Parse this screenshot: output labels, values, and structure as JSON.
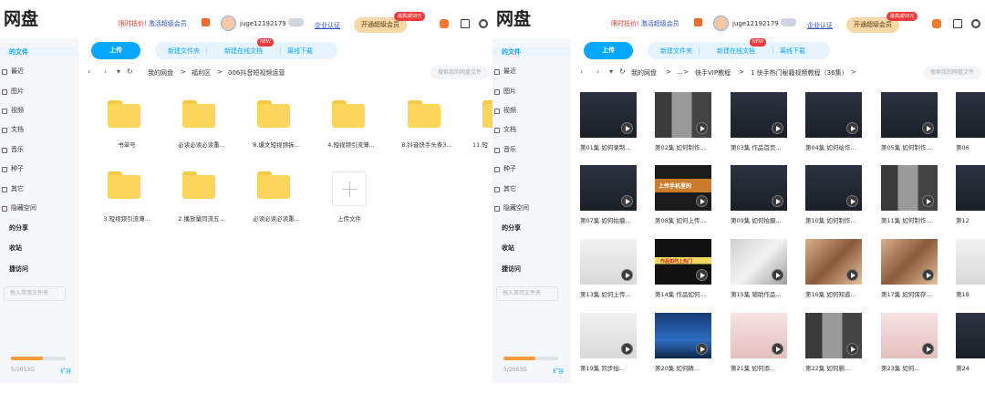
{
  "left": {
    "brand": "网盘",
    "topbar": {
      "promo_prefix": "限时抵价!",
      "promo_text": "激活超级会员",
      "username": "juge12192179",
      "cert_label": "企业认证",
      "open_vip_label": "开通超级会员",
      "discount_badge": "最高减58元"
    },
    "sidebar": {
      "items": [
        {
          "label": "的文件",
          "type": "active"
        },
        {
          "label": "最近",
          "type": "sub"
        },
        {
          "label": "图片",
          "type": "sub"
        },
        {
          "label": "视频",
          "type": "sub"
        },
        {
          "label": "文档",
          "type": "sub"
        },
        {
          "label": "音乐",
          "type": "sub"
        },
        {
          "label": "种子",
          "type": "sub"
        },
        {
          "label": "其它",
          "type": "sub"
        },
        {
          "label": "隐藏空间",
          "type": "sub"
        },
        {
          "label": "的分享",
          "type": "bold"
        },
        {
          "label": "收站",
          "type": "bold"
        },
        {
          "label": "捷访问",
          "type": "bold"
        }
      ],
      "add_folder_placeholder": "拖入常用文件夹",
      "quota_text": "5/2053G",
      "expand_label": "扩容",
      "quota_fraction": 0.58
    },
    "toolbar": {
      "upload_label": "上传",
      "new_folder_label": "新建文件夹",
      "new_online_doc_label": "新建在线文档",
      "offline_download_label": "离线下载",
      "new_badge": "NEW"
    },
    "breadcrumb": [
      "我的网盘",
      "福利区",
      "006抖音短视频运营"
    ],
    "search_placeholder": "搜索我的网盘文件",
    "folders": [
      {
        "name": "书单号"
      },
      {
        "name": "必读必读必读重..."
      },
      {
        "name": "8.爆文短视频拆..."
      },
      {
        "name": "4.短视频引流薄..."
      },
      {
        "name": "8.抖音快手头条3..."
      },
      {
        "name": "11.短"
      },
      {
        "name": "3.短视频引流薄..."
      },
      {
        "name": "2.播放量同流五..."
      },
      {
        "name": "必读必读必读重..."
      }
    ],
    "upload_tile_label": "上传文件"
  },
  "right": {
    "brand": "网盘",
    "topbar": {
      "promo_prefix": "限时抵价!",
      "promo_text": "激活超级会员",
      "username": "juge12192179",
      "cert_label": "企业认证",
      "open_vip_label": "开通超级会员",
      "discount_badge": "最高减58元"
    },
    "sidebar": {
      "items": [
        {
          "label": "的文件",
          "type": "active"
        },
        {
          "label": "最近",
          "type": "sub"
        },
        {
          "label": "图片",
          "type": "sub"
        },
        {
          "label": "视频",
          "type": "sub"
        },
        {
          "label": "文档",
          "type": "sub"
        },
        {
          "label": "音乐",
          "type": "sub"
        },
        {
          "label": "种子",
          "type": "sub"
        },
        {
          "label": "其它",
          "type": "sub"
        },
        {
          "label": "隐藏空间",
          "type": "sub"
        },
        {
          "label": "的分享",
          "type": "bold"
        },
        {
          "label": "收站",
          "type": "bold"
        },
        {
          "label": "捷访问",
          "type": "bold"
        }
      ],
      "add_folder_placeholder": "拖入常用文件夹",
      "quota_text": "5/2053G",
      "expand_label": "扩容",
      "quota_fraction": 0.58
    },
    "toolbar": {
      "upload_label": "上传",
      "new_folder_label": "新建文件夹",
      "new_online_doc_label": "新建在线文档",
      "offline_download_label": "离线下载",
      "new_badge": "NEW"
    },
    "breadcrumb": [
      "我的网盘",
      "...",
      "快手VIP教程",
      "1 快手热门秘籍视频教程（36集）"
    ],
    "search_placeholder": "搜索我的网盘文件",
    "videos": [
      {
        "label": "第01集 如何录制...",
        "theme": "dark"
      },
      {
        "label": "第02集 如何制作...",
        "theme": "gray"
      },
      {
        "label": "第03集 作品首页...",
        "theme": "dark"
      },
      {
        "label": "第04集 如何给作...",
        "theme": "dark"
      },
      {
        "label": "第05集 如何制作...",
        "theme": "dark"
      },
      {
        "label": "第06",
        "theme": "dark"
      },
      {
        "label": "第07集 如何拍摄...",
        "theme": "dark"
      },
      {
        "label": "第08集 如何上传...",
        "theme": "orange"
      },
      {
        "label": "第09集 如何拍摄...",
        "theme": "dark"
      },
      {
        "label": "第10集 如何制作...",
        "theme": "dark"
      },
      {
        "label": "第11集 如何制作...",
        "theme": "gray"
      },
      {
        "label": "第12",
        "theme": "dark"
      },
      {
        "label": "第13集 如何上传...",
        "theme": "phone"
      },
      {
        "label": "第14集 作品如何...",
        "theme": "black"
      },
      {
        "label": "第15集 辅助作品...",
        "theme": "light"
      },
      {
        "label": "第16集 如何知道...",
        "theme": "photo"
      },
      {
        "label": "第17集 如何保存...",
        "theme": "photo"
      },
      {
        "label": "第18",
        "theme": "phone"
      },
      {
        "label": "第19集 同步拍...",
        "theme": "phone"
      },
      {
        "label": "第20集 如何精...",
        "theme": "blue"
      },
      {
        "label": "第21集 如何添...",
        "theme": "portrait"
      },
      {
        "label": "第22集 如何删...",
        "theme": "gray"
      },
      {
        "label": "第23集 如何...",
        "theme": "portrait"
      },
      {
        "label": "第24",
        "theme": "dark"
      }
    ],
    "video_text": {
      "v8_title": "上传手机里的",
      "v13_title": "作品如何上热门"
    }
  },
  "colors": {
    "accent": "#06a7ff",
    "folder": "#fbd65c",
    "vip": "#f6d9a6",
    "badge": "#ef3b3b"
  }
}
